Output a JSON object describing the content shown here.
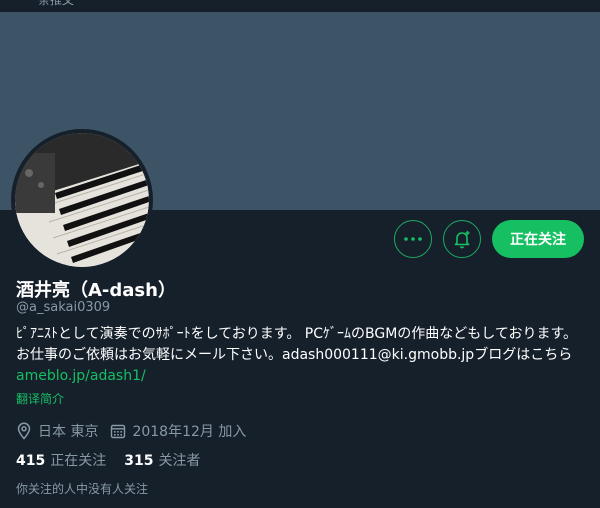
{
  "topbar": {
    "partial_text": "条推文"
  },
  "actions": {
    "more_icon": "more-dots-icon",
    "notify_icon": "bell-plus-icon",
    "follow_label": "正在关注"
  },
  "profile": {
    "name": "酒井亮（A-dash）",
    "handle": "@a_sakai0309",
    "bio_text": "ﾋﾟｱﾆｽﾄとして演奏でのｻﾎﾟｰﾄをしております。 PCｹﾞｰﾑのBGMの作曲などもしております。お仕事のご依頼はお気軽にメール下さい。adash000111@ki.gmobb.jpブログはこちら",
    "bio_link": "ameblo.jp/adash1/",
    "translate_label": "翻译简介",
    "location": "日本 東京",
    "joined": "2018年12月 加入"
  },
  "stats": {
    "following_count": "415",
    "following_label": "正在关注",
    "followers_count": "315",
    "followers_label": "关注者"
  },
  "mutual_text": "你关注的人中没有人关注",
  "colors": {
    "background": "#15202b",
    "banner": "#3d5466",
    "accent": "#17bf63",
    "muted": "#8899a6"
  }
}
